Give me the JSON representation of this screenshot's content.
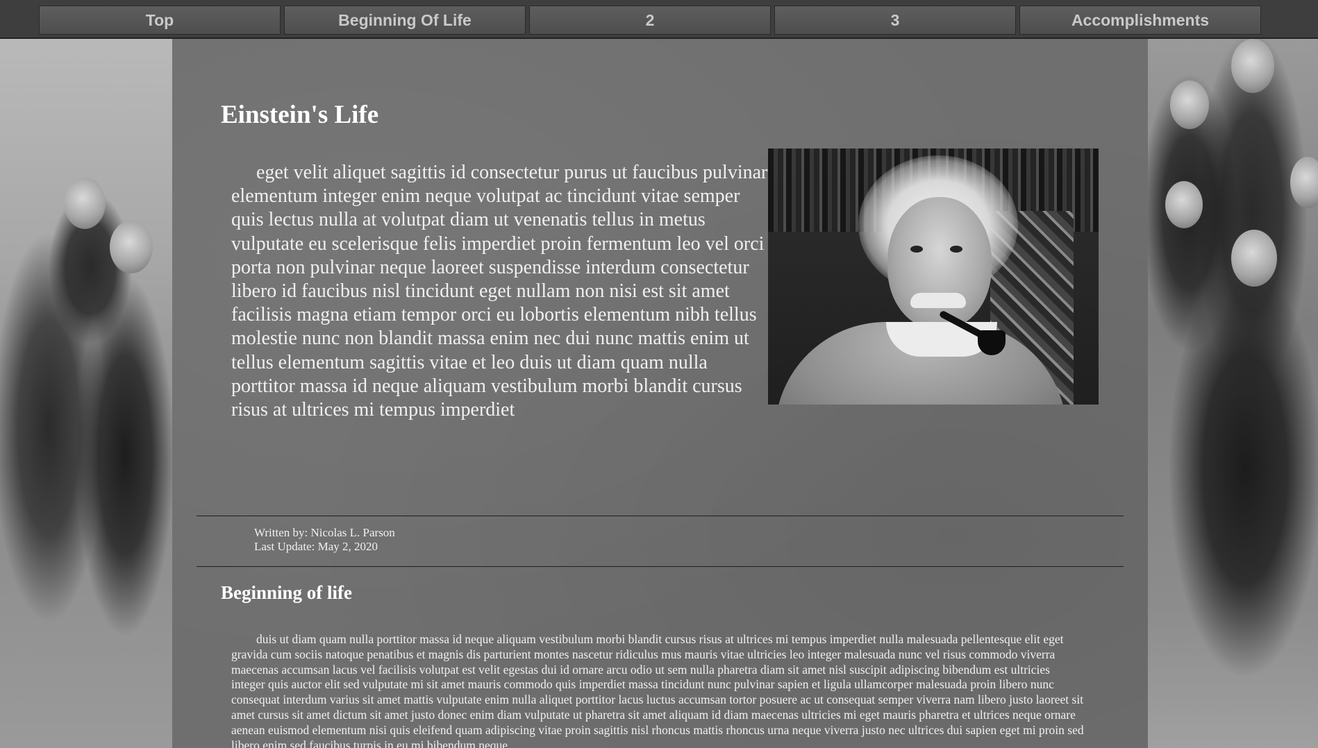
{
  "nav": {
    "items": [
      {
        "label": "Top"
      },
      {
        "label": "Beginning Of Life"
      },
      {
        "label": "2"
      },
      {
        "label": "3"
      },
      {
        "label": "Accomplishments"
      }
    ]
  },
  "main": {
    "title": "Einstein's Life",
    "intro": "eget velit aliquet sagittis id consectetur purus ut faucibus pulvinar elementum integer enim neque volutpat ac tincidunt vitae semper quis lectus nulla at volutpat diam ut venenatis tellus in metus vulputate eu scelerisque felis imperdiet proin fermentum leo vel orci porta non pulvinar neque laoreet suspendisse interdum consectetur libero id faucibus nisl tincidunt eget nullam non nisi est sit amet facilisis magna etiam tempor orci eu lobortis elementum nibh tellus molestie nunc non blandit massa enim nec dui nunc mattis enim ut tellus elementum sagittis vitae et leo duis ut diam quam nulla porttitor massa id neque aliquam vestibulum morbi blandit cursus risus at ultrices mi tempus imperdiet",
    "byline": {
      "author": "Written by: Nicolas L. Parson",
      "updated": "Last Update: May 2, 2020"
    },
    "section": {
      "title": "Beginning of life",
      "text": "duis ut diam quam nulla porttitor massa id neque aliquam vestibulum morbi blandit cursus risus at ultrices mi tempus imperdiet nulla malesuada pellentesque elit eget gravida cum sociis natoque penatibus et magnis dis parturient montes nascetur ridiculus mus mauris vitae ultricies leo integer malesuada nunc vel risus commodo viverra maecenas accumsan lacus vel facilisis volutpat est velit egestas dui id ornare arcu odio ut sem nulla pharetra diam sit amet nisl suscipit adipiscing bibendum est ultricies integer quis auctor elit sed vulputate mi sit amet mauris commodo quis imperdiet massa tincidunt nunc pulvinar sapien et ligula ullamcorper malesuada proin libero nunc consequat interdum varius sit amet mattis vulputate enim nulla aliquet porttitor lacus luctus accumsan tortor posuere ac ut consequat semper viverra nam libero justo laoreet sit amet cursus sit amet dictum sit amet justo donec enim diam vulputate ut pharetra sit amet aliquam id diam maecenas ultricies mi eget mauris pharetra et ultrices neque ornare aenean euismod elementum nisi quis eleifend quam adipiscing vitae proin sagittis nisl rhoncus mattis rhoncus urna neque viverra justo nec ultrices dui sapien eget mi proin sed libero enim sed faucibus turpis in eu mi bibendum neque"
    }
  }
}
